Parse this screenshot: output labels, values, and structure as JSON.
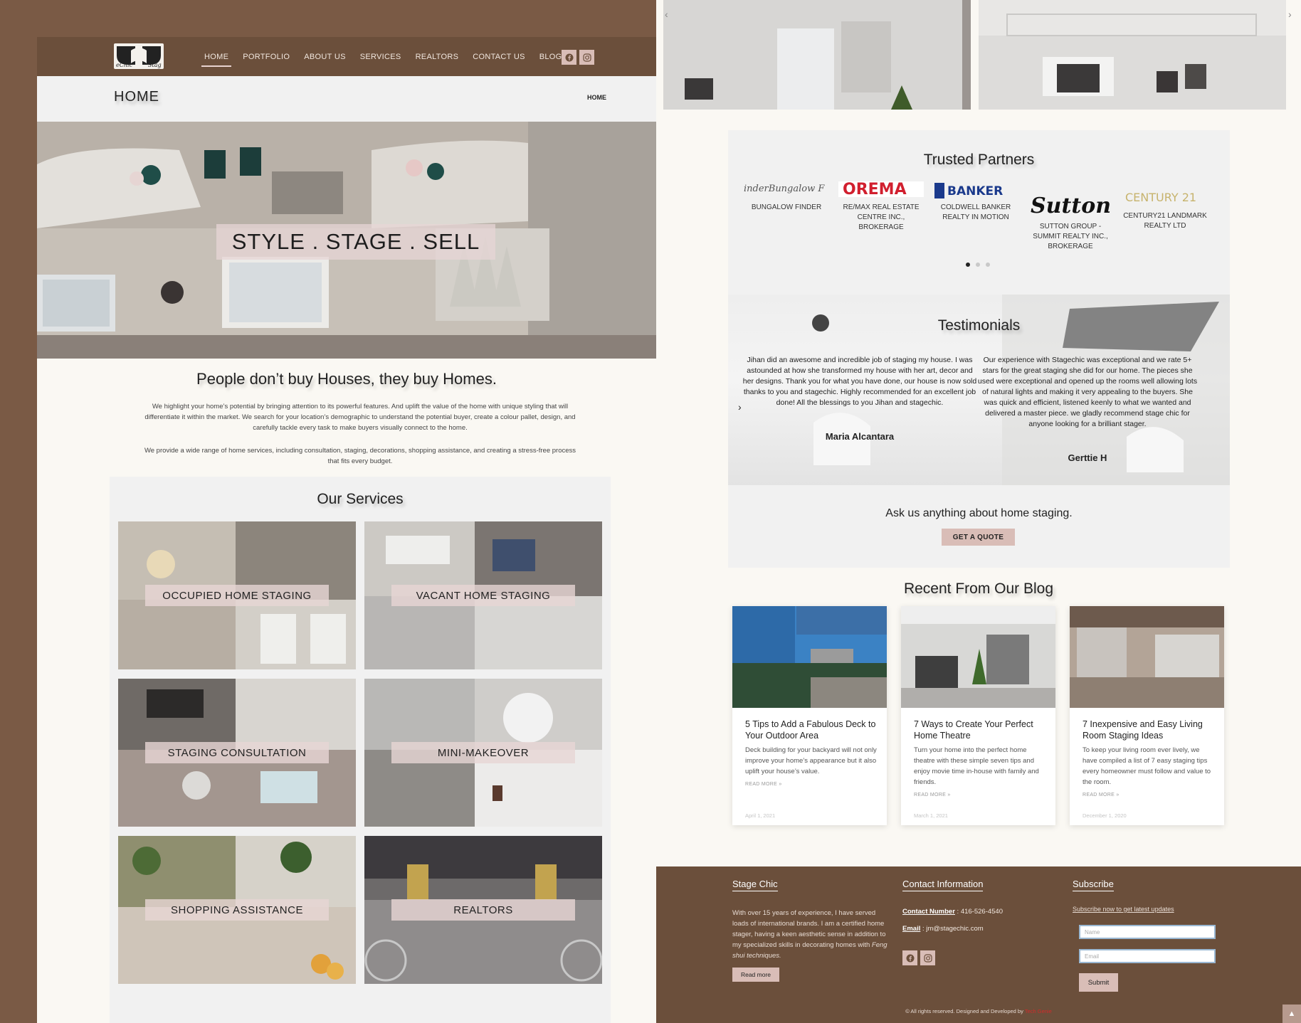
{
  "nav": {
    "logo_alt": "Stage Chic",
    "links": [
      "HOME",
      "PORTFOLIO",
      "ABOUT US",
      "SERVICES",
      "REALTORS",
      "CONTACT US",
      "BLOG"
    ],
    "social_icons": [
      "facebook-icon",
      "instagram-icon"
    ]
  },
  "title_bar": {
    "title": "HOME",
    "breadcrumb": "HOME"
  },
  "hero": {
    "caption": "STYLE . STAGE . SELL"
  },
  "intro": {
    "heading": "People don’t buy Houses, they buy Homes.",
    "p1": "We highlight your home’s potential by bringing attention to its powerful features. And uplift the value of the home with unique styling that will differentiate it within the market. We search for your location’s demographic to understand the potential buyer, create a colour pallet, design, and carefully tackle every task to make buyers visually connect to the home.",
    "p2": "We provide a wide range of home services, including consultation, staging, decorations, shopping assistance, and creating a stress-free process that fits every budget."
  },
  "services": {
    "heading": "Our Services",
    "items": [
      "OCCUPIED HOME STAGING",
      "VACANT HOME STAGING",
      "STAGING CONSULTATION",
      "MINI-MAKEOVER",
      "SHOPPING ASSISTANCE",
      "REALTORS"
    ]
  },
  "partners": {
    "heading": "Trusted Partners",
    "items": [
      {
        "logo": "inderBungalow F",
        "name": "BUNGALOW FINDER"
      },
      {
        "logo": "OREMA",
        "name": "RE/MAX REAL ESTATE CENTRE INC., BROKERAGE"
      },
      {
        "logo": "BANKER",
        "name": "COLDWELL BANKER REALTY IN MOTION"
      },
      {
        "logo": "Sutton S",
        "name": "SUTTON GROUP - SUMMIT REALTY INC., BROKERAGE"
      },
      {
        "logo": "CENTURY 21",
        "name": "CENTURY21 LANDMARK REALTY LTD"
      }
    ]
  },
  "testimonials": {
    "heading": "Testimonials",
    "items": [
      {
        "text": "Jihan did an awesome and incredible job of staging my house. I was astounded at how she transformed my house with her art, decor and her designs. Thank you for what you have done, our house is now sold thanks to you and stagechic. Highly recommended for an excellent job done! All the blessings to you Jihan and stagechic.",
        "name": "Maria Alcantara"
      },
      {
        "text": "Our experience with Stagechic was exceptional and we rate 5+ stars for the great staging she did for our home. The pieces she used were exceptional and opened up the rooms well allowing lots of natural lights and making it very appealing to the buyers. She was quick and efficient, listened keenly to what we wanted and delivered a master piece. we gladly recommend stage chic for anyone looking for a brilliant stager.",
        "name": "Gerttie H"
      }
    ]
  },
  "cta": {
    "text": "Ask us anything about home staging.",
    "button": "GET A QUOTE"
  },
  "blog": {
    "heading": "Recent From Our Blog",
    "posts": [
      {
        "title": "5 Tips to Add a Fabulous Deck to Your Outdoor Area",
        "excerpt": "Deck building for your backyard will not only improve your home’s appearance but it also uplift your house’s value.",
        "read_more": "READ MORE »",
        "date": "April 1, 2021"
      },
      {
        "title": "7 Ways to Create Your Perfect Home Theatre",
        "excerpt": "Turn your home into the perfect home theatre with these simple seven tips and enjoy movie time in-house with family and friends.",
        "read_more": "READ MORE »",
        "date": "March 1, 2021"
      },
      {
        "title": "7 Inexpensive and Easy Living Room Staging Ideas",
        "excerpt": "To keep your living room ever lively, we have compiled a list of 7 easy staging tips every homeowner must follow and value to the room.",
        "read_more": "READ MORE »",
        "date": "December 1, 2020"
      }
    ]
  },
  "footer": {
    "about_heading": "Stage Chic",
    "about_text": "With over 15 years of experience, I have served loads of international brands. I am a certified home stager, having a keen aesthetic sense in addition to my specialized skills in decorating homes with ",
    "about_italic": "Feng shui techniques.",
    "read_more": "Read more",
    "contact_heading": "Contact Information",
    "contact_label": "Contact Number",
    "contact_value": " : 416-526-4540",
    "email_label": "Email",
    "email_value": " : jm@stagechic.com",
    "subscribe_heading": "Subscribe",
    "subscribe_text": "Subscribe now to get latest updates",
    "name_placeholder": "Name",
    "email_placeholder": "Email",
    "submit": "Submit",
    "copyright": "© All rights reserved. Designed and Developed by ",
    "developer": "Tech Genie"
  }
}
